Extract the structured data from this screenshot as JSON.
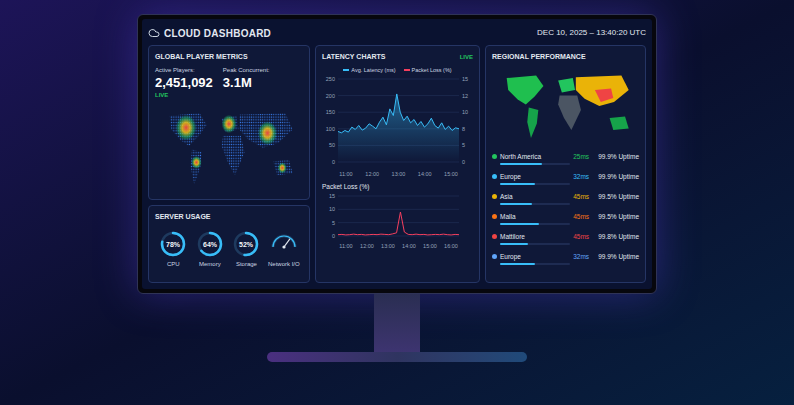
{
  "header": {
    "title": "CLOUD DASHBOARD",
    "datetime": "DEC 10, 2025 – 13:40:20 UTC"
  },
  "player_metrics": {
    "title": "GLOBAL PLAYER METRICS",
    "stats": [
      {
        "label": "Active Players:",
        "value": "2,451,092"
      },
      {
        "label": "Peak Concurrent:",
        "value": "3.1M"
      }
    ],
    "live": "LIVE"
  },
  "server_usage": {
    "title": "SERVER USAGE",
    "gauges": [
      {
        "label": "CPU",
        "reading": "78%",
        "level": 0.78,
        "kind": "ring"
      },
      {
        "label": "Memory",
        "reading": "64%",
        "level": 0.64,
        "kind": "ring"
      },
      {
        "label": "Storage",
        "reading": "52%",
        "level": 0.52,
        "kind": "ring"
      },
      {
        "label": "Network I/O",
        "level": 0.7,
        "kind": "needle"
      }
    ]
  },
  "latency": {
    "title": "LATENCY CHARTS",
    "live": "LIVE",
    "legend": [
      {
        "label": "Avg. Latency (ms)",
        "color": "#38bdf8"
      },
      {
        "label": "Packet Loss (%)",
        "color": "#f43f5e"
      }
    ],
    "y_ticks": [
      "250",
      "200",
      "150",
      "100",
      "50",
      "0"
    ],
    "y_ticks_right": [
      "15",
      "12",
      "10",
      "8",
      "5",
      "0"
    ],
    "x_ticks": [
      "11:00",
      "12:00",
      "13:00",
      "14:00",
      "15:00"
    ],
    "values": [
      92,
      88,
      95,
      90,
      105,
      98,
      110,
      96,
      102,
      115,
      108,
      100,
      120,
      135,
      112,
      160,
      140,
      205,
      150,
      125,
      138,
      118,
      128,
      110,
      122,
      105,
      115,
      132,
      110,
      102,
      118,
      98,
      108,
      95,
      103,
      100
    ]
  },
  "packet_loss": {
    "title": "Packet Loss (%)",
    "y_ticks": [
      "15",
      "10",
      "5",
      "0"
    ],
    "x_ticks": [
      "11:00",
      "12:00",
      "13:00",
      "14:00",
      "15:00",
      "16:00"
    ],
    "values": [
      0.5,
      0.6,
      0.4,
      0.5,
      0.7,
      0.5,
      0.6,
      0.4,
      0.5,
      0.6,
      0.5,
      0.7,
      0.6,
      0.5,
      0.8,
      1.2,
      9,
      1.5,
      0.6,
      0.5,
      0.7,
      0.5,
      0.6,
      0.4,
      0.5,
      0.6,
      0.5,
      0.7,
      0.5,
      0.4,
      0.6,
      0.5
    ]
  },
  "regions": {
    "title": "REGIONAL PERFORMANCE",
    "rows": [
      {
        "name": "North America",
        "latency": "25ms",
        "uptime": "99.9% Uptime",
        "level": 0.6,
        "color": "#22c55e"
      },
      {
        "name": "Europe",
        "latency": "32ms",
        "uptime": "99.9% Uptime",
        "level": 0.5,
        "color": "#38bdf8"
      },
      {
        "name": "Asia",
        "latency": "45ms",
        "uptime": "99.5% Uptime",
        "level": 0.45,
        "color": "#eab308"
      },
      {
        "name": "Malla",
        "latency": "45ms",
        "uptime": "99.5% Uptime",
        "level": 0.55,
        "color": "#f97316"
      },
      {
        "name": "Mattilore",
        "latency": "45ms",
        "uptime": "99.8% Uptime",
        "level": 0.4,
        "color": "#ef4444"
      },
      {
        "name": "Europe",
        "latency": "32ms",
        "uptime": "99.9% Uptime",
        "level": 0.5,
        "color": "#60a5fa"
      }
    ]
  }
}
